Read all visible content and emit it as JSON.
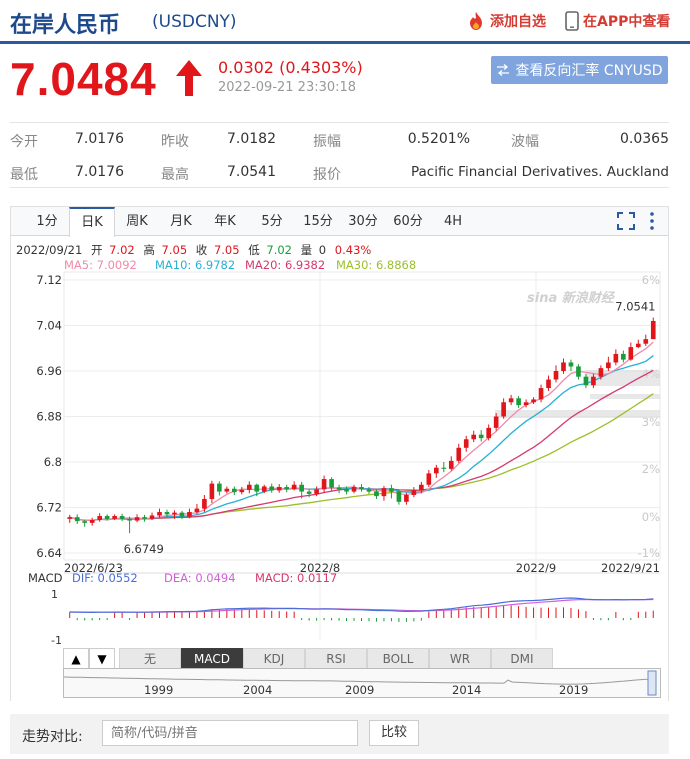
{
  "header": {
    "title": "在岸人民币",
    "code": "(USDCNY)",
    "add_fav": "添加自选",
    "app_view": "在APP中查看"
  },
  "quote": {
    "price": "7.0484",
    "change": "0.0302 (0.4303%)",
    "time": "2022-09-21 23:30:18",
    "reverse_btn": "查看反向汇率 CNYUSD"
  },
  "stats": [
    {
      "label": "今开",
      "value": "7.0176"
    },
    {
      "label": "昨收",
      "value": "7.0182"
    },
    {
      "label": "振幅",
      "value": "0.5201%"
    },
    {
      "label": "波幅",
      "value": "0.0365"
    },
    {
      "label": "最低",
      "value": "7.0176"
    },
    {
      "label": "最高",
      "value": "7.0541"
    },
    {
      "label": "报价",
      "value": "Pacific Financial Derivatives. Auckland"
    }
  ],
  "tabs": [
    "1分",
    "日K",
    "周K",
    "月K",
    "年K",
    "5分",
    "15分",
    "30分",
    "60分",
    "4H"
  ],
  "active_tab": "日K",
  "info_line": {
    "date": "2022/09/21",
    "open_label": "开",
    "open": "7.02",
    "high_label": "高",
    "high": "7.05",
    "close_label": "收",
    "close": "7.05",
    "low_label": "低",
    "low": "7.02",
    "vol_label": "量",
    "vol": "0",
    "pct": "0.43%"
  },
  "ma_legend": {
    "ma5": "MA5: 7.0092",
    "ma10": "MA10: 6.9782",
    "ma20": "MA20: 6.9382",
    "ma30": "MA30: 6.8868"
  },
  "macd_legend": {
    "title": "MACD",
    "dif": "DIF: 0.0552",
    "dea": "DEA: 0.0494",
    "macd": "MACD: 0.0117"
  },
  "watermark": "sina 新浪财经",
  "indicators": [
    "无",
    "MACD",
    "KDJ",
    "RSI",
    "BOLL",
    "WR",
    "DMI"
  ],
  "active_indicator": "MACD",
  "nav_years": [
    "1999",
    "2004",
    "2009",
    "2014",
    "2019"
  ],
  "compare": {
    "label": "走势对比:",
    "placeholder": "简称/代码/拼音",
    "button": "比较"
  },
  "colors": {
    "up": "#e0161b",
    "down": "#1a9c3a",
    "ma5": "#f08aa8",
    "ma10": "#26b0d6",
    "ma20": "#d63870",
    "ma30": "#9cbf2a",
    "dif": "#4a6ed8",
    "dea": "#d060d8",
    "brand": "#1e4a8c"
  },
  "chart_data": {
    "type": "candlestick",
    "y_ticks": [
      "7.12",
      "7.04",
      "6.96",
      "6.88",
      "6.8",
      "6.72",
      "6.64"
    ],
    "ylim": [
      6.64,
      7.12
    ],
    "pct_ticks": [
      "6%",
      "4%",
      "3%",
      "2%",
      "0%",
      "-1%"
    ],
    "x_ticks": [
      "2022/6/23",
      "2022/8",
      "2022/9",
      "2022/9/21"
    ],
    "high_label": "7.0541",
    "low_label": "6.6749",
    "macd_ticks": [
      "1",
      "-1"
    ],
    "candles": [
      [
        6.7,
        6.703,
        6.707,
        6.693
      ],
      [
        6.703,
        6.696,
        6.708,
        6.691
      ],
      [
        6.696,
        6.693,
        6.699,
        6.686
      ],
      [
        6.693,
        6.698,
        6.702,
        6.688
      ],
      [
        6.698,
        6.705,
        6.71,
        6.695
      ],
      [
        6.705,
        6.7,
        6.708,
        6.697
      ],
      [
        6.7,
        6.705,
        6.708,
        6.698
      ],
      [
        6.705,
        6.7,
        6.709,
        6.696
      ],
      [
        6.7,
        6.697,
        6.704,
        6.675
      ],
      [
        6.697,
        6.703,
        6.708,
        6.694
      ],
      [
        6.703,
        6.7,
        6.707,
        6.695
      ],
      [
        6.7,
        6.706,
        6.711,
        6.698
      ],
      [
        6.706,
        6.712,
        6.718,
        6.702
      ],
      [
        6.712,
        6.708,
        6.716,
        6.703
      ],
      [
        6.708,
        6.711,
        6.715,
        6.7
      ],
      [
        6.711,
        6.704,
        6.714,
        6.7
      ],
      [
        6.704,
        6.712,
        6.718,
        6.701
      ],
      [
        6.712,
        6.718,
        6.726,
        6.708
      ],
      [
        6.718,
        6.735,
        6.742,
        6.712
      ],
      [
        6.735,
        6.762,
        6.767,
        6.728
      ],
      [
        6.762,
        6.748,
        6.766,
        6.741
      ],
      [
        6.748,
        6.753,
        6.757,
        6.745
      ],
      [
        6.753,
        6.747,
        6.757,
        6.742
      ],
      [
        6.747,
        6.751,
        6.756,
        6.743
      ],
      [
        6.751,
        6.76,
        6.766,
        6.745
      ],
      [
        6.76,
        6.748,
        6.762,
        6.74
      ],
      [
        6.748,
        6.757,
        6.76,
        6.745
      ],
      [
        6.757,
        6.75,
        6.762,
        6.746
      ],
      [
        6.75,
        6.756,
        6.761,
        6.746
      ],
      [
        6.756,
        6.752,
        6.76,
        6.747
      ],
      [
        6.752,
        6.76,
        6.766,
        6.75
      ],
      [
        6.76,
        6.748,
        6.765,
        6.736
      ],
      [
        6.748,
        6.744,
        6.752,
        6.738
      ],
      [
        6.744,
        6.752,
        6.757,
        6.74
      ],
      [
        6.752,
        6.77,
        6.776,
        6.746
      ],
      [
        6.77,
        6.755,
        6.773,
        6.748
      ],
      [
        6.755,
        6.752,
        6.76,
        6.745
      ],
      [
        6.752,
        6.748,
        6.757,
        6.743
      ],
      [
        6.748,
        6.756,
        6.76,
        6.745
      ],
      [
        6.756,
        6.752,
        6.761,
        6.748
      ],
      [
        6.752,
        6.748,
        6.756,
        6.744
      ],
      [
        6.748,
        6.74,
        6.752,
        6.735
      ],
      [
        6.74,
        6.754,
        6.758,
        6.732
      ],
      [
        6.754,
        6.748,
        6.76,
        6.736
      ],
      [
        6.748,
        6.73,
        6.752,
        6.725
      ],
      [
        6.73,
        6.742,
        6.746,
        6.725
      ],
      [
        6.742,
        6.75,
        6.756,
        6.738
      ],
      [
        6.75,
        6.76,
        6.765,
        6.745
      ],
      [
        6.76,
        6.78,
        6.786,
        6.756
      ],
      [
        6.78,
        6.79,
        6.795,
        6.772
      ],
      [
        6.79,
        6.788,
        6.8,
        6.782
      ],
      [
        6.788,
        6.802,
        6.81,
        6.785
      ],
      [
        6.802,
        6.825,
        6.832,
        6.798
      ],
      [
        6.825,
        6.84,
        6.846,
        6.818
      ],
      [
        6.84,
        6.848,
        6.855,
        6.835
      ],
      [
        6.848,
        6.842,
        6.856,
        6.836
      ],
      [
        6.842,
        6.86,
        6.866,
        6.838
      ],
      [
        6.86,
        6.88,
        6.886,
        6.855
      ],
      [
        6.88,
        6.905,
        6.912,
        6.876
      ],
      [
        6.905,
        6.912,
        6.918,
        6.9
      ],
      [
        6.912,
        6.9,
        6.916,
        6.895
      ],
      [
        6.9,
        6.905,
        6.91,
        6.896
      ],
      [
        6.905,
        6.91,
        6.914,
        6.902
      ],
      [
        6.91,
        6.93,
        6.936,
        6.905
      ],
      [
        6.93,
        6.945,
        6.952,
        6.925
      ],
      [
        6.945,
        6.96,
        6.97,
        6.94
      ],
      [
        6.96,
        6.975,
        6.982,
        6.955
      ],
      [
        6.975,
        6.968,
        6.98,
        6.96
      ],
      [
        6.968,
        6.95,
        6.972,
        6.945
      ],
      [
        6.95,
        6.935,
        6.955,
        6.93
      ],
      [
        6.935,
        6.95,
        6.955,
        6.93
      ],
      [
        6.95,
        6.965,
        6.97,
        6.945
      ],
      [
        6.965,
        6.975,
        6.985,
        6.96
      ],
      [
        6.975,
        6.99,
        6.998,
        6.97
      ],
      [
        6.99,
        6.98,
        6.996,
        6.975
      ],
      [
        6.98,
        7.002,
        7.01,
        6.978
      ],
      [
        7.002,
        7.008,
        7.015,
        7.0
      ],
      [
        7.008,
        7.016,
        7.024,
        7.004
      ],
      [
        7.016,
        7.048,
        7.054,
        7.018
      ]
    ]
  }
}
